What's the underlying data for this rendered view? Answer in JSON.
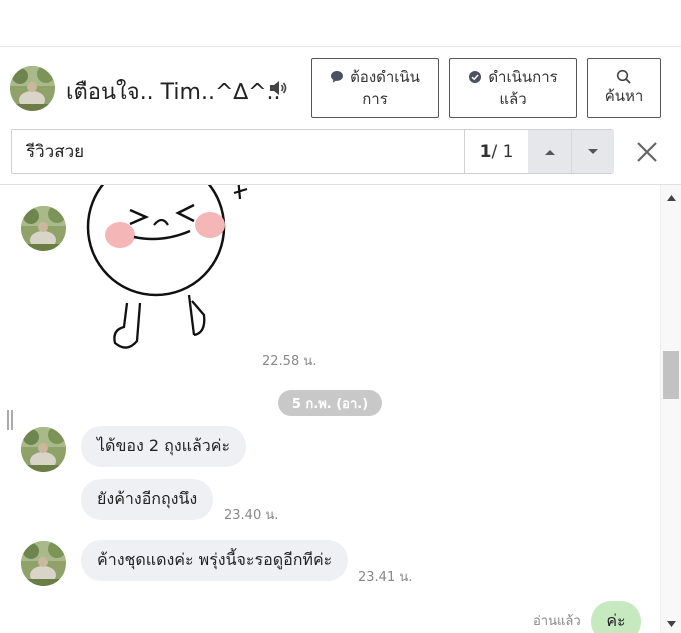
{
  "header": {
    "chat_name": "เตือนใจ.. Tim..^∆^..",
    "avatar_icon": "user-avatar",
    "speaker_icon": "speaker-icon",
    "buttons": {
      "todo": {
        "line1": "ต้องดำเนิน",
        "line2": "การ",
        "icon": "chat-bubble-icon"
      },
      "done": {
        "line1": "ดำเนินการ",
        "line2": "แล้ว",
        "icon": "check-circle-icon"
      },
      "search": {
        "label": "ค้นหา",
        "icon": "search-icon"
      }
    }
  },
  "search": {
    "value": "รีวิวสวย",
    "current": "1",
    "total": "/ 1",
    "up_icon": "chevron-up-icon",
    "down_icon": "chevron-down-icon",
    "close_icon": "close-icon"
  },
  "messages": {
    "sticker_time": "22.58 น.",
    "date_separator": "5 ก.พ. (อา.)",
    "msg1": "ได้ของ 2 ถุงแล้วค่ะ",
    "msg2": "ยังค้างอีกถุงนึง",
    "msg2_time": "23.40 น.",
    "msg3": "ค้างชุดแดงค่ะ พรุ่งนี้จะรอดูอีกทีค่ะ",
    "msg3_time": "23.41 น.",
    "read_label": "อ่านแล้ว",
    "my_msg": "ค่ะ"
  },
  "colors": {
    "incoming_bubble": "#eef0f3",
    "outgoing_bubble": "#c6e9c0",
    "date_pill": "#c8c8c8",
    "nav_button": "#e6e7ea"
  }
}
